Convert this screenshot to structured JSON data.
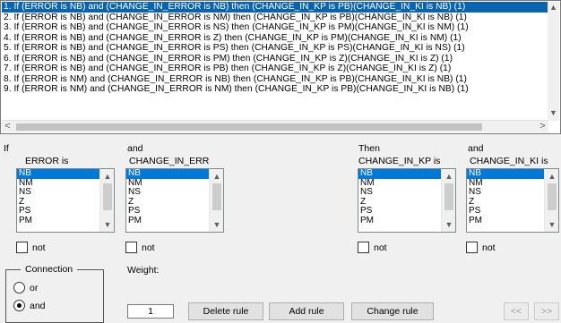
{
  "rules": [
    "1. If (ERROR is NB) and (CHANGE_IN_ERROR is NB) then (CHANGE_IN_KP is PB)(CHANGE_IN_KI is NB) (1)",
    "2. If (ERROR is NB) and (CHANGE_IN_ERROR is NM) then (CHANGE_IN_KP is PB)(CHANGE_IN_KI is NB) (1)",
    "3. If (ERROR is NB) and (CHANGE_IN_ERROR is NS) then (CHANGE_IN_KP is PM)(CHANGE_IN_KI is NM) (1)",
    "4. If (ERROR is NB) and (CHANGE_IN_ERROR is Z) then (CHANGE_IN_KP is PM)(CHANGE_IN_KI is NM) (1)",
    "5. If (ERROR is NB) and (CHANGE_IN_ERROR is PS) then (CHANGE_IN_KP is PS)(CHANGE_IN_KI is NS) (1)",
    "6. If (ERROR is NB) and (CHANGE_IN_ERROR is PM) then (CHANGE_IN_KP is Z)(CHANGE_IN_KI is Z) (1)",
    "7. If (ERROR is NB) and (CHANGE_IN_ERROR is PB) then (CHANGE_IN_KP is Z)(CHANGE_IN_KI is Z) (1)",
    "8. If (ERROR is NM) and (CHANGE_IN_ERROR is NB) then (CHANGE_IN_KP is PB)(CHANGE_IN_KI is NB) (1)",
    "9. If (ERROR is NM) and (CHANGE_IN_ERROR is NM) then (CHANGE_IN_KP is PB)(CHANGE_IN_KI is NB) (1)"
  ],
  "selected_rule_index": 0,
  "columns": [
    {
      "prefix": "If",
      "name": "ERROR is",
      "options": [
        "NB",
        "NM",
        "NS",
        "Z",
        "PS",
        "PM"
      ],
      "selected": "NB",
      "not_label": "not"
    },
    {
      "prefix": "and",
      "name": "CHANGE_IN_ERR",
      "options": [
        "NB",
        "NM",
        "NS",
        "Z",
        "PS",
        "PM"
      ],
      "selected": "NB",
      "not_label": "not"
    },
    {
      "prefix": "Then",
      "name": "CHANGE_IN_KP is",
      "options": [
        "NB",
        "NM",
        "NS",
        "Z",
        "PS",
        "PM"
      ],
      "selected": "NB",
      "not_label": "not"
    },
    {
      "prefix": "and",
      "name": "CHANGE_IN_KI is",
      "options": [
        "NB",
        "NM",
        "NS",
        "Z",
        "PS",
        "PM"
      ],
      "selected": "NB",
      "not_label": "not"
    }
  ],
  "connection": {
    "title": "Connection",
    "options": [
      "or",
      "and"
    ],
    "selected": "and"
  },
  "weight": {
    "label": "Weight:",
    "value": "1"
  },
  "buttons": {
    "delete": "Delete rule",
    "add": "Add rule",
    "change": "Change rule",
    "prev": "<<",
    "next": ">>"
  },
  "icons": {
    "scroll_up": "▲",
    "scroll_down": "▼",
    "scroll_left": "<",
    "scroll_right": ">"
  },
  "colors": {
    "selection": "#0a64ad",
    "list_selection": "#0078d7"
  }
}
